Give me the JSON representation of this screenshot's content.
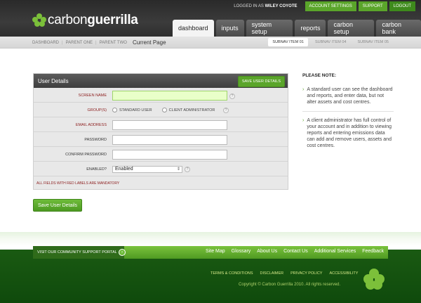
{
  "header": {
    "logo_light": "carbon",
    "logo_bold": "guerrilla",
    "logged_in_prefix": "LOGGED IN AS",
    "logged_in_user": "WILEY COYOTE",
    "top_buttons": [
      "ACCOUNT SETTINGS",
      "SUPPORT",
      "LOGOUT"
    ],
    "tabs": [
      "dashboard",
      "inputs",
      "system setup",
      "reports",
      "carbon setup",
      "carbon bank"
    ],
    "active_tab": "dashboard"
  },
  "subnav": {
    "crumbs": [
      "DASHBOARD",
      "PARENT ONE",
      "PARENT TWO"
    ],
    "current": "Current Page",
    "items": [
      "SUBNAV ITEM 01",
      "SUBNAV ITEM 04",
      "SUBNAV ITEM 05"
    ]
  },
  "form": {
    "title": "User Details",
    "save_top": "SAVE USER DETAILS",
    "labels": {
      "screen_name": "SCREEN NAME",
      "groups": "GROUP(S)",
      "email": "EMAIL ADDRESS",
      "password": "PASSWORD",
      "confirm": "CONFIRM PASSWORD",
      "enabled": "ENABLED?"
    },
    "radio_standard": "STANDARD USER",
    "radio_admin": "CLIENT ADMINISTRATOR",
    "enabled_value": "Enabled",
    "mandatory_note": "ALL FIELDS WITH RED LABELS ARE MANDATORY",
    "save_bottom": "Save User Details"
  },
  "note": {
    "title": "PLEASE NOTE:",
    "items": [
      "A standard user can see the dashboard and reports, and enter data, but not alter assets and cost centres.",
      "A client administrator has full control of your account and in addition to viewing reports and entering emissions data can add and remove users, assets and cost centres."
    ]
  },
  "footer": {
    "portal": "VISIT OUR COMMUNITY SUPPORT PORTAL",
    "nav": [
      "Site Map",
      "Glossary",
      "About Us",
      "Contact Us",
      "Additional Services",
      "Feedback"
    ],
    "links": [
      "TERMS & CONDITIONS",
      "DISCLAIMER",
      "PRIVACY POLICY",
      "ACCESSIBILITY"
    ],
    "copyright": "Copyright © Carbon Guerrilla 2010. All rights reserved."
  }
}
